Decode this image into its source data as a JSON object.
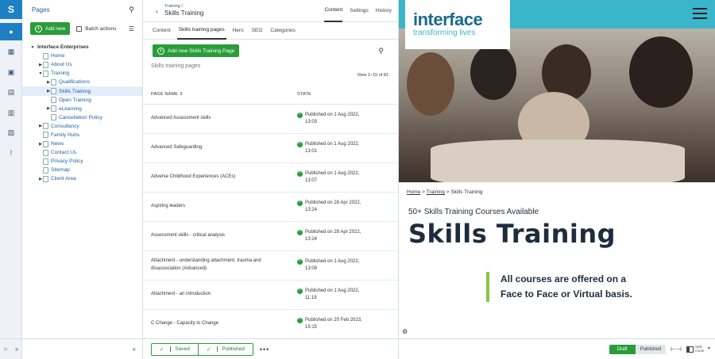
{
  "rail": {
    "logo": "S",
    "items": [
      {
        "name": "users-icon",
        "glyph": "●"
      },
      {
        "name": "sitemap-icon",
        "glyph": "▦"
      },
      {
        "name": "image-icon",
        "glyph": "▣"
      },
      {
        "name": "document-icon",
        "glyph": "▤"
      },
      {
        "name": "report-icon",
        "glyph": "▥"
      },
      {
        "name": "files-icon",
        "glyph": "▧"
      },
      {
        "name": "help-icon",
        "glyph": "!"
      }
    ],
    "bottom_left": "○",
    "bottom_right": "»"
  },
  "tree": {
    "title": "Pages",
    "add_new": "Add new",
    "batch_actions": "Batch actions",
    "collapse": "«",
    "items": [
      {
        "label": "Interface Enterprises",
        "depth": 0,
        "caret": "▼",
        "root": true
      },
      {
        "label": "Home",
        "depth": 1,
        "caret": ""
      },
      {
        "label": "About Us",
        "depth": 1,
        "caret": "▶"
      },
      {
        "label": "Training",
        "depth": 1,
        "caret": "▼"
      },
      {
        "label": "Qualifications",
        "depth": 2,
        "caret": "▶"
      },
      {
        "label": "Skills Training",
        "depth": 2,
        "caret": "▶",
        "selected": true
      },
      {
        "label": "Open Training",
        "depth": 2,
        "caret": ""
      },
      {
        "label": "eLearning",
        "depth": 2,
        "caret": "▶"
      },
      {
        "label": "Cancellation Policy",
        "depth": 2,
        "caret": ""
      },
      {
        "label": "Consultancy",
        "depth": 1,
        "caret": "▶"
      },
      {
        "label": "Family Hubs",
        "depth": 1,
        "caret": ""
      },
      {
        "label": "News",
        "depth": 1,
        "caret": "▶"
      },
      {
        "label": "Contact Us",
        "depth": 1,
        "caret": ""
      },
      {
        "label": "Privacy Policy",
        "depth": 1,
        "caret": ""
      },
      {
        "label": "Sitemap",
        "depth": 1,
        "caret": ""
      },
      {
        "label": "Client Area",
        "depth": 1,
        "caret": "▶"
      }
    ]
  },
  "mid": {
    "back": "‹",
    "crumb_parent": "Training /",
    "crumb_title": "Skills Training",
    "top_tabs": [
      {
        "label": "Content",
        "active": true
      },
      {
        "label": "Settings",
        "active": false
      },
      {
        "label": "History",
        "active": false
      }
    ],
    "sub_tabs": [
      {
        "label": "Content",
        "active": false
      },
      {
        "label": "Skills training pages",
        "active": true
      },
      {
        "label": "Hero",
        "active": false
      },
      {
        "label": "SEO",
        "active": false
      },
      {
        "label": "Categories",
        "active": false
      }
    ],
    "add_button": "Add new Skills Training Page",
    "section_label": "Skills training pages",
    "view_count": "View 1–15 of 81",
    "col_name": "PAGE NAME ⇕",
    "col_state": "STATE",
    "rows": [
      {
        "name": "Advanced Assessment skills",
        "state": "Published on 1 Aug 2022, 13:03"
      },
      {
        "name": "Advanced Safeguarding",
        "state": "Published on 1 Aug 2022, 13:01"
      },
      {
        "name": "Adverse Childhood Experiences (ACEs)",
        "state": "Published on 1 Aug 2022, 13:07"
      },
      {
        "name": "Aspiring leaders",
        "state": "Published on 28 Apr 2022, 13:24"
      },
      {
        "name": "Assessment skills - critical analysis",
        "state": "Published on 28 Apr 2022, 13:24"
      },
      {
        "name": "Attachment - understanding attachment, trauma and disassociation (Advanced)",
        "state": "Published on 1 Aug 2022, 13:09"
      },
      {
        "name": "Attachment - an introduction",
        "state": "Published on 1 Aug 2022, 11:19"
      },
      {
        "name": "C Change - Capacity to Change",
        "state": "Published on 20 Feb 2023, 15:15"
      }
    ],
    "saved": "Saved",
    "published": "Published",
    "more": "•••"
  },
  "preview": {
    "logo_word": "interface",
    "logo_tag": "transforming lives",
    "crumb_home": "Home",
    "crumb_training": "Training",
    "crumb_current": "Skills Training",
    "crumb_sep": ">",
    "subheading": "50+ Skills Training Courses Available",
    "heading": "Skills Training",
    "quote": "All courses are offered on a Face to Face or Virtual basis.",
    "gear": "⚙",
    "draft": "Draft",
    "published": "Published",
    "split_mode": "Split mode",
    "dropdown": "▾",
    "colors": {
      "teal": "#3ab5c9",
      "green": "#8cc63f",
      "navy": "#1e2d3d"
    }
  }
}
